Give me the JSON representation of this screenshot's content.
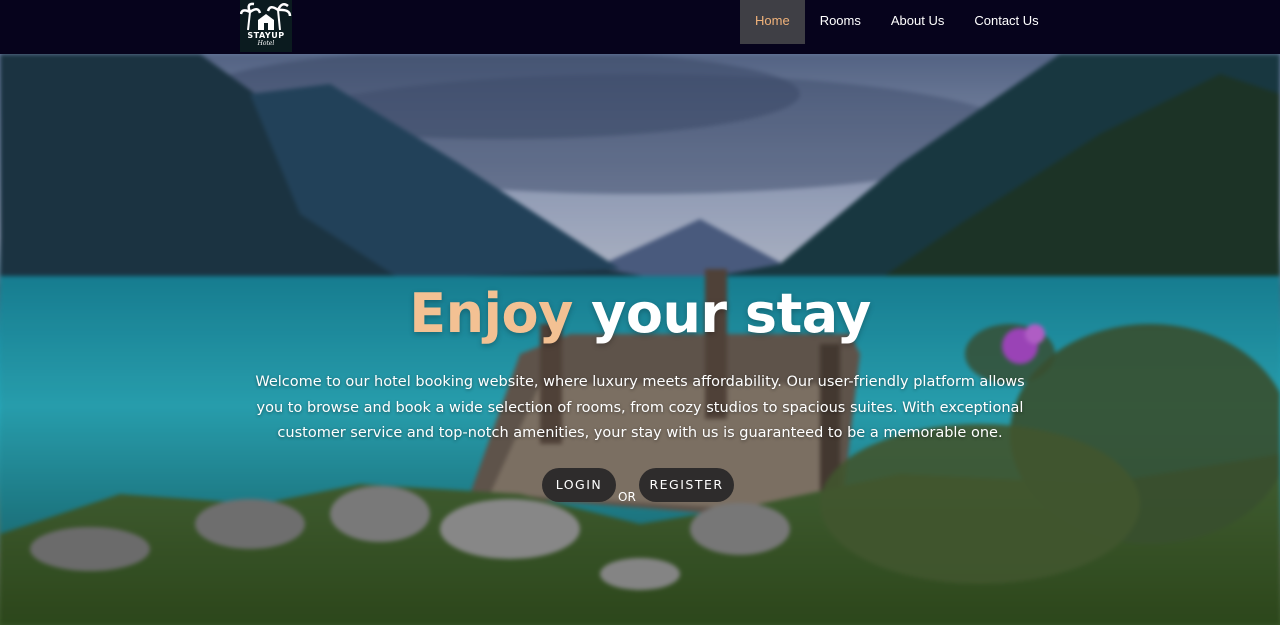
{
  "nav": {
    "logo": {
      "brand": "STAYUP",
      "sub": "Hotel",
      "icon": "palm-tree-icon"
    },
    "links": [
      {
        "label": "Home",
        "active": true
      },
      {
        "label": "Rooms",
        "active": false
      },
      {
        "label": "About Us",
        "active": false
      },
      {
        "label": "Contact Us",
        "active": false
      }
    ]
  },
  "hero": {
    "headline_accent": "Enjoy",
    "headline_rest": "your stay",
    "intro": "Welcome to our hotel booking website, where luxury meets affordability. Our user-friendly platform allows you to browse and book a wide selection of rooms, from cozy studios to spacious suites. With exceptional customer service and top-notch amenities, your stay with us is guaranteed to be a memorable one.",
    "login_label": "LOGIN",
    "or_label": "OR",
    "register_label": "REGISTER"
  },
  "colors": {
    "navbar_bg": "#06031c",
    "active_link_bg": "#3f3f45",
    "active_link_text": "#f0b27a",
    "headline_accent": "#f3c193",
    "button_bg": "#2e2c2c"
  }
}
